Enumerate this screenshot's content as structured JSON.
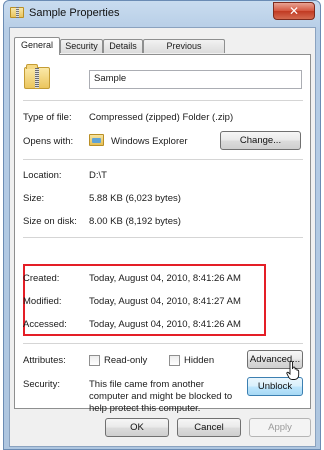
{
  "window": {
    "title": "Sample Properties",
    "close_glyph": "✕"
  },
  "tabs": [
    "General",
    "Security",
    "Details",
    "Previous Versions"
  ],
  "general": {
    "name_value": "Sample",
    "type_label": "Type of file:",
    "type_value": "Compressed (zipped) Folder (.zip)",
    "opens_label": "Opens with:",
    "opens_value": "Windows Explorer",
    "change_button": "Change...",
    "location_label": "Location:",
    "location_value": "D:\\T",
    "size_label": "Size:",
    "size_value": "5.88 KB (6,023 bytes)",
    "sizeondisk_label": "Size on disk:",
    "sizeondisk_value": "8.00 KB (8,192 bytes)",
    "created_label": "Created:",
    "created_value": "Today, August 04, 2010, 8:41:26 AM",
    "modified_label": "Modified:",
    "modified_value": "Today, August 04, 2010, 8:41:27 AM",
    "accessed_label": "Accessed:",
    "accessed_value": "Today, August 04, 2010, 8:41:26 AM",
    "attributes_label": "Attributes:",
    "readonly_label": "Read-only",
    "hidden_label": "Hidden",
    "advanced_button": "Advanced...",
    "security_label": "Security:",
    "security_text_1": "This file came from another",
    "security_text_2": "computer and might be blocked to",
    "security_text_3": "help protect this computer.",
    "unblock_button": "Unblock"
  },
  "footer": {
    "ok": "OK",
    "cancel": "Cancel",
    "apply": "Apply"
  },
  "colors": {
    "highlight": "#e41e26",
    "title_bar": "#c9dcef",
    "close": "#d4563f"
  }
}
